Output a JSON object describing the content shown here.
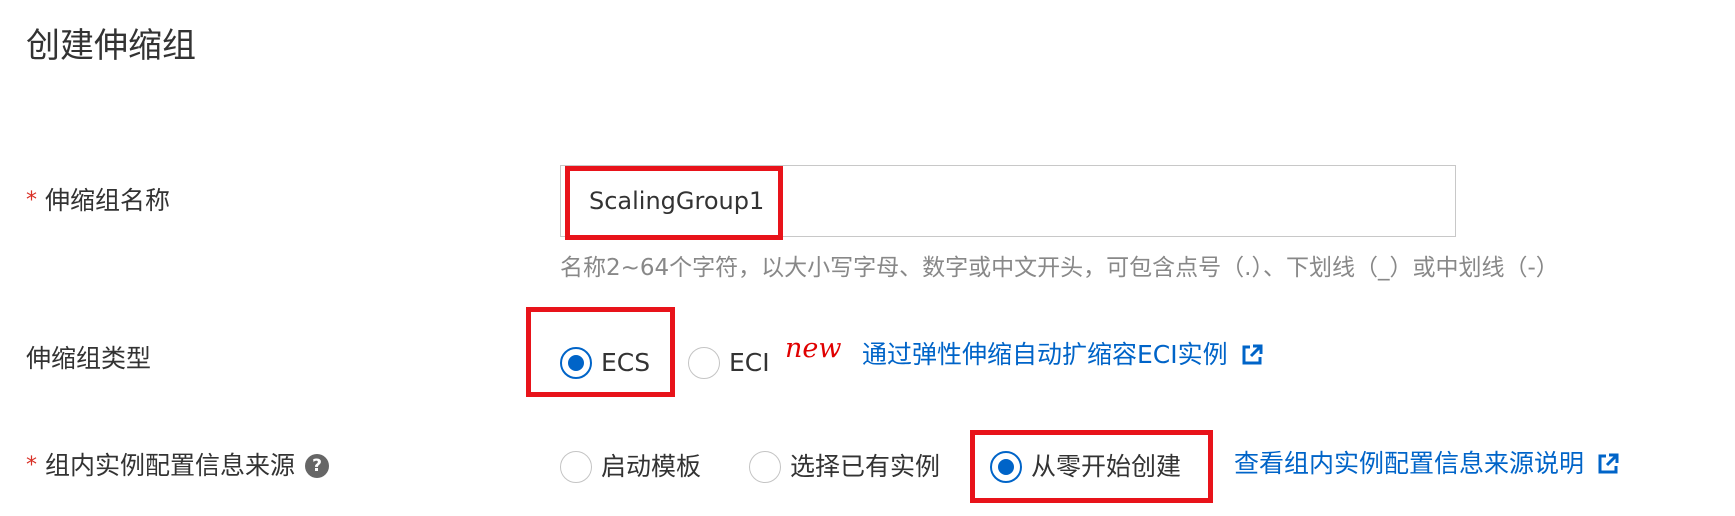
{
  "page": {
    "title": "创建伸缩组"
  },
  "form": {
    "name_field": {
      "required_mark": "*",
      "label": "伸缩组名称",
      "value": "ScalingGroup1",
      "hint": "名称2~64个字符，以大小写字母、数字或中文开头，可包含点号（.）、下划线（_）或中划线（-）"
    },
    "group_type": {
      "label": "伸缩组类型",
      "options": [
        {
          "label": "ECS",
          "selected": true
        },
        {
          "label": "ECI",
          "selected": false
        }
      ],
      "new_badge": "new",
      "link_text": "通过弹性伸缩自动扩缩容ECI实例",
      "link_icon": "external-link-icon"
    },
    "config_source": {
      "required_mark": "*",
      "label": "组内实例配置信息来源",
      "help_icon": "?",
      "options": [
        {
          "label": "启动模板",
          "selected": false
        },
        {
          "label": "选择已有实例",
          "selected": false
        },
        {
          "label": "从零开始创建",
          "selected": true
        }
      ],
      "link_text": "查看组内实例配置信息来源说明",
      "link_icon": "external-link-icon"
    }
  },
  "colors": {
    "primary": "#0064c8",
    "required": "#d93026",
    "highlight": "#e8131a",
    "badge": "#e00000",
    "hint": "#888888"
  }
}
